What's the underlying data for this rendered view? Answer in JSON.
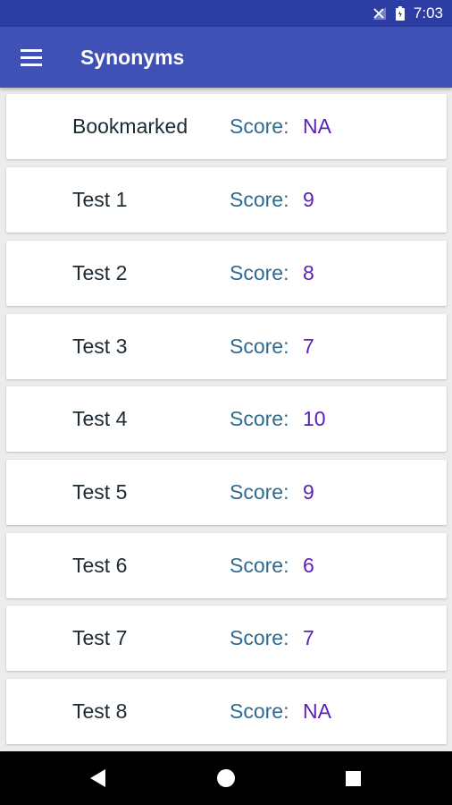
{
  "status_bar": {
    "time": "7:03",
    "icons": [
      "signal-off-icon",
      "battery-icon"
    ]
  },
  "app_bar": {
    "menu_icon": "hamburger-menu-icon",
    "title": "Synonyms"
  },
  "list": {
    "items": [
      {
        "title": "Bookmarked",
        "score_label": "Score:",
        "score": "NA"
      },
      {
        "title": "Test 1",
        "score_label": "Score:",
        "score": "9"
      },
      {
        "title": "Test 2",
        "score_label": "Score:",
        "score": "8"
      },
      {
        "title": "Test 3",
        "score_label": "Score:",
        "score": "7"
      },
      {
        "title": "Test 4",
        "score_label": "Score:",
        "score": "10"
      },
      {
        "title": "Test 5",
        "score_label": "Score:",
        "score": "9"
      },
      {
        "title": "Test 6",
        "score_label": "Score:",
        "score": "6"
      },
      {
        "title": "Test 7",
        "score_label": "Score:",
        "score": "7"
      },
      {
        "title": "Test 8",
        "score_label": "Score:",
        "score": "NA"
      }
    ]
  },
  "nav_bar": {
    "icons": [
      "back-icon",
      "home-icon",
      "recents-icon"
    ]
  },
  "colors": {
    "status_bar": "#2c3ea3",
    "app_bar": "#3f51b5",
    "score_label": "#2f6a8f",
    "score_value": "#5b21b6"
  }
}
